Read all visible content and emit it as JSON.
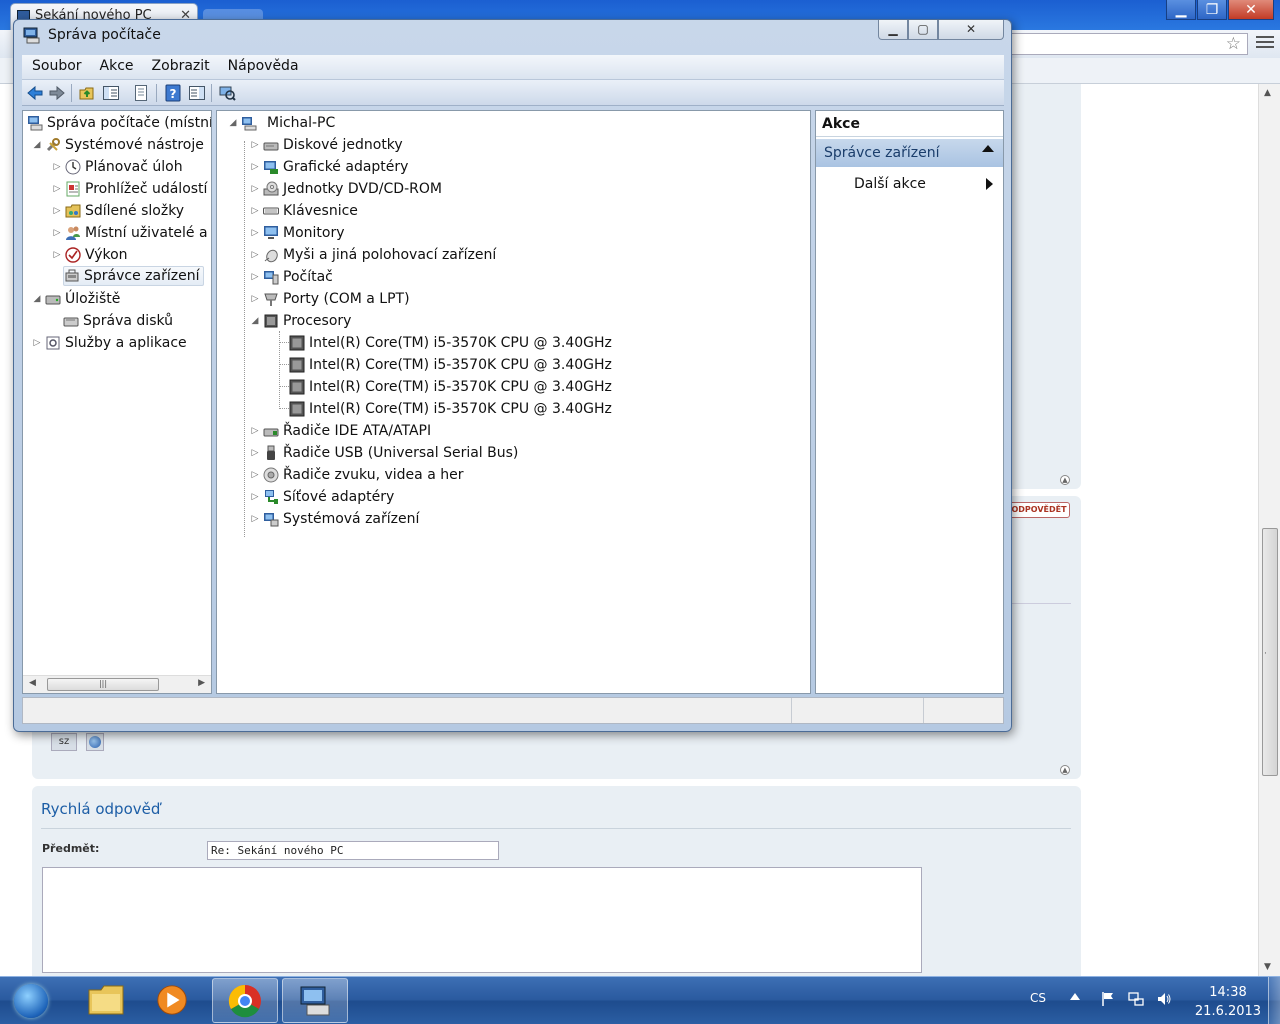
{
  "browser": {
    "tab_title": "Sekání nového PC",
    "tab_close": "✕",
    "window_controls": {
      "minimize": "▁",
      "restore": "❐",
      "close": "✕"
    },
    "bookmark_star": "☆"
  },
  "forum": {
    "reply_button": "ODPOVĚDĚT",
    "user_badge": "sz",
    "quick_reply_title": "Rychlá odpověď",
    "subject_label": "Předmět:",
    "subject_value": "Re: Sekání nového PC"
  },
  "mmc": {
    "title": "Správa počítače",
    "title_buttons": {
      "minimize": "▁",
      "maximize": "▢",
      "close": "✕"
    },
    "menu": [
      "Soubor",
      "Akce",
      "Zobrazit",
      "Nápověda"
    ],
    "tree": {
      "root": "Správa počítače (místní)",
      "system_tools": "Systémové nástroje",
      "task_scheduler": "Plánovač úloh",
      "event_viewer": "Prohlížeč událostí",
      "shared_folders": "Sdílené složky",
      "local_users": "Místní uživatelé a s",
      "performance": "Výkon",
      "device_manager": "Správce zařízení",
      "storage": "Úložiště",
      "disk_management": "Správa disků",
      "services": "Služby a aplikace"
    },
    "devices": {
      "computer": "Michal-PC",
      "categories": [
        "Diskové jednotky",
        "Grafické adaptéry",
        "Jednotky DVD/CD-ROM",
        "Klávesnice",
        "Monitory",
        "Myši a jiná polohovací zařízení",
        "Počítač",
        "Porty (COM a LPT)",
        "Procesory"
      ],
      "processors": [
        "Intel(R) Core(TM) i5-3570K CPU @ 3.40GHz",
        "Intel(R) Core(TM) i5-3570K CPU @ 3.40GHz",
        "Intel(R) Core(TM) i5-3570K CPU @ 3.40GHz",
        "Intel(R) Core(TM) i5-3570K CPU @ 3.40GHz"
      ],
      "categories_after": [
        "Řadiče IDE ATA/ATAPI",
        "Řadiče USB (Universal Serial Bus)",
        "Řadiče zvuku, videa a her",
        "Síťové adaptéry",
        "Systémová zařízení"
      ]
    },
    "actions": {
      "header": "Akce",
      "section": "Správce zařízení",
      "more": "Další akce"
    }
  },
  "taskbar": {
    "language": "CS",
    "time": "14:38",
    "date": "21.6.2013"
  },
  "colors": {
    "taskbar": "#2a5a9f",
    "mmc_frame": "#c8d7ea",
    "action_section": "#b9cfe8",
    "link_blue": "#1d5ea6"
  }
}
